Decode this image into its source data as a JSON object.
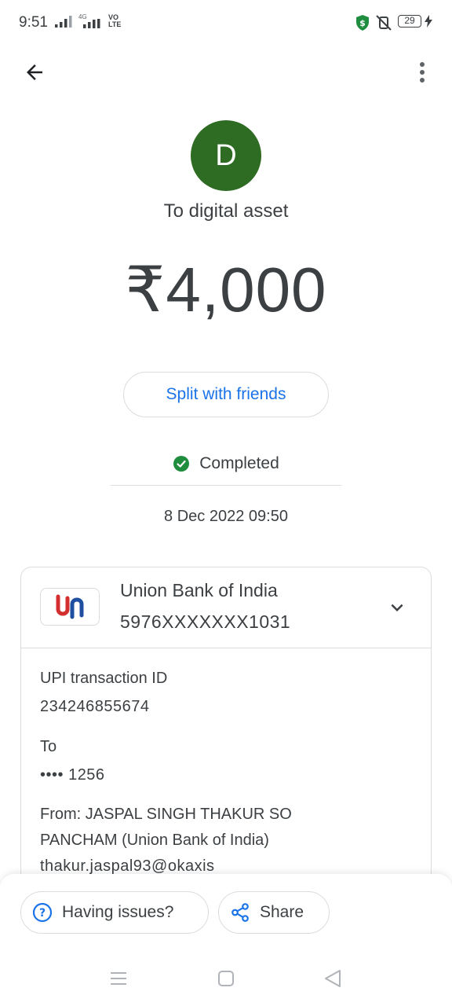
{
  "status_bar": {
    "time": "9:51",
    "network_label_top": "4G",
    "volte_top": "VO",
    "volte_bottom": "LTE",
    "battery": "29",
    "icons": [
      "signal-icon",
      "signal-4g-icon",
      "volte-icon",
      "shield-icon",
      "mute-icon",
      "battery-icon",
      "charging-icon"
    ]
  },
  "header": {
    "back_icon": "arrow-back-icon",
    "more_icon": "more-vert-icon"
  },
  "payment": {
    "avatar_letter": "D",
    "avatar_color": "#2e6b23",
    "recipient": "To digital asset",
    "amount": "₹4,000",
    "split_button": "Split with friends",
    "status": "Completed",
    "status_color": "#1e8e3e",
    "datetime": "8 Dec 2022 09:50"
  },
  "account": {
    "bank_name": "Union Bank of India",
    "account_number": "5976XXXXXXX1031"
  },
  "details": {
    "upi_label": "UPI transaction ID",
    "upi_id": "234246855674",
    "to_label": "To",
    "to_value": "•••• 1256",
    "from_line1": "From: JASPAL SINGH THAKUR SO",
    "from_line2": "PANCHAM (Union Bank of India)",
    "from_upi": "thakur.jaspal93@okaxis"
  },
  "actions": {
    "issues": "Having issues?",
    "share": "Share"
  },
  "colors": {
    "accent": "#1a73e8",
    "text": "#3c4043",
    "border": "#dadce0"
  }
}
